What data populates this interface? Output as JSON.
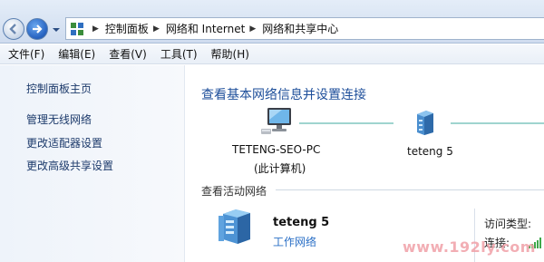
{
  "address_bar": {
    "crumbs": [
      "控制面板",
      "网络和 Internet",
      "网络和共享中心"
    ]
  },
  "menu": {
    "items": [
      "文件(F)",
      "编辑(E)",
      "查看(V)",
      "工具(T)",
      "帮助(H)"
    ]
  },
  "sidebar": {
    "home": "控制面板主页",
    "links": [
      "管理无线网络",
      "更改适配器设置",
      "更改高级共享设置"
    ]
  },
  "main": {
    "title": "查看基本网络信息并设置连接",
    "computer_name": "TETENG-SEO-PC",
    "computer_sub": "(此计算机)",
    "router_name": "teteng  5",
    "active_section": "查看活动网络",
    "active_network": {
      "name": "teteng  5",
      "type": "工作网络"
    },
    "access_type_label": "访问类型:",
    "connection_label": "连接:"
  },
  "watermark": "www.192ly.com",
  "colors": {
    "title_blue": "#1d4e9a",
    "link_blue": "#2a6fc6",
    "map_line": "#9fd4cf",
    "watermark": "#f0a0a8"
  }
}
